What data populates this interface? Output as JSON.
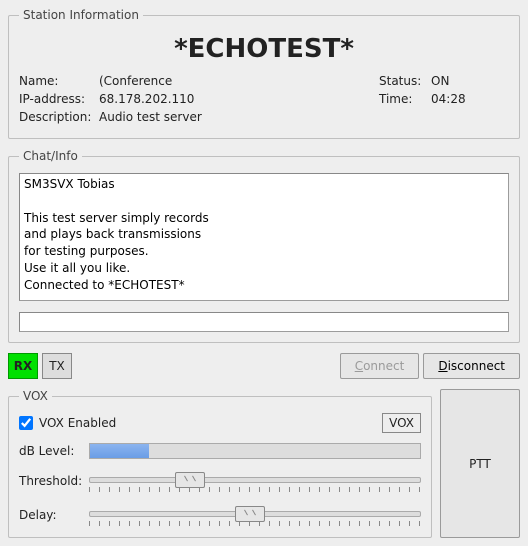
{
  "station": {
    "legend": "Station Information",
    "title": "*ECHOTEST*",
    "name_label": "Name:",
    "name_value": "(Conference",
    "ip_label": "IP-address:",
    "ip_value": "68.178.202.110",
    "desc_label": "Description:",
    "desc_value": "Audio test server",
    "status_label": "Status:",
    "status_value": "ON",
    "time_label": "Time:",
    "time_value": "04:28"
  },
  "chat": {
    "legend": "Chat/Info",
    "log": "SM3SVX Tobias\n\nThis test server simply records\nand plays back transmissions\nfor testing purposes.\nUse it all you like.\nConnected to *ECHOTEST*",
    "input_value": ""
  },
  "indicators": {
    "rx": "RX",
    "tx": "TX",
    "rx_active": true
  },
  "buttons": {
    "connect": "Connect",
    "disconnect": "Disconnect",
    "ptt": "PTT"
  },
  "vox": {
    "legend": "VOX",
    "enabled_label": "VOX Enabled",
    "enabled": true,
    "badge": "VOX",
    "db_label": "dB Level:",
    "db_fill_percent": 18,
    "threshold_label": "Threshold:",
    "threshold_percent": 28,
    "delay_label": "Delay:",
    "delay_percent": 46
  }
}
